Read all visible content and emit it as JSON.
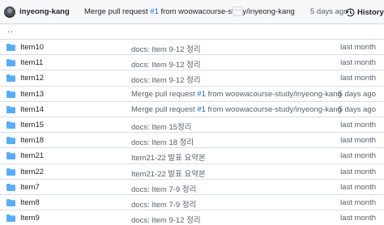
{
  "commit": {
    "author": "inyeong-kang",
    "message_prefix": "Merge pull request ",
    "issue": "#1",
    "message_suffix": " from woowacourse-study/inyeong-kang",
    "dots": "···",
    "date": "5 days ago",
    "history_label": "History"
  },
  "parent_link": "..",
  "accent_color": "#0969da",
  "folder_color": "#54aeff",
  "rows": [
    {
      "name": "Item10",
      "icon": "folder-icon",
      "msg_prefix": "docs: Item 9-12 정리",
      "issue": "",
      "msg_suffix": "",
      "date": "last month"
    },
    {
      "name": "Item11",
      "icon": "folder-icon",
      "msg_prefix": "docs: Item 9-12 정리",
      "issue": "",
      "msg_suffix": "",
      "date": "last month"
    },
    {
      "name": "Item12",
      "icon": "folder-icon",
      "msg_prefix": "docs: Item 9-12 정리",
      "issue": "",
      "msg_suffix": "",
      "date": "last month"
    },
    {
      "name": "Item13",
      "icon": "folder-icon",
      "msg_prefix": "Merge pull request ",
      "issue": "#1",
      "msg_suffix": " from woowacourse-study/inyeong-kang",
      "date": "5 days ago"
    },
    {
      "name": "Item14",
      "icon": "folder-icon",
      "msg_prefix": "Merge pull request ",
      "issue": "#1",
      "msg_suffix": " from woowacourse-study/inyeong-kang",
      "date": "5 days ago"
    },
    {
      "name": "Item15",
      "icon": "folder-icon",
      "msg_prefix": "docs: Item 15정리",
      "issue": "",
      "msg_suffix": "",
      "date": "last month"
    },
    {
      "name": "Item18",
      "icon": "folder-icon",
      "msg_prefix": "docs: Item 18 정리",
      "issue": "",
      "msg_suffix": "",
      "date": "last month"
    },
    {
      "name": "Item21",
      "icon": "folder-icon",
      "msg_prefix": "Item21-22 발표 요약본",
      "issue": "",
      "msg_suffix": "",
      "date": "last month"
    },
    {
      "name": "Item22",
      "icon": "folder-icon",
      "msg_prefix": "Item21-22 발표 요약본",
      "issue": "",
      "msg_suffix": "",
      "date": "last month"
    },
    {
      "name": "Item7",
      "icon": "folder-icon",
      "msg_prefix": "docs: Item 7-9 정리",
      "issue": "",
      "msg_suffix": "",
      "date": "last month"
    },
    {
      "name": "Item8",
      "icon": "folder-icon",
      "msg_prefix": "docs: Item 7-9 정리",
      "issue": "",
      "msg_suffix": "",
      "date": "last month"
    },
    {
      "name": "Item9",
      "icon": "folder-icon",
      "msg_prefix": "docs: Item 9-12 정리",
      "issue": "",
      "msg_suffix": "",
      "date": "last month"
    }
  ]
}
